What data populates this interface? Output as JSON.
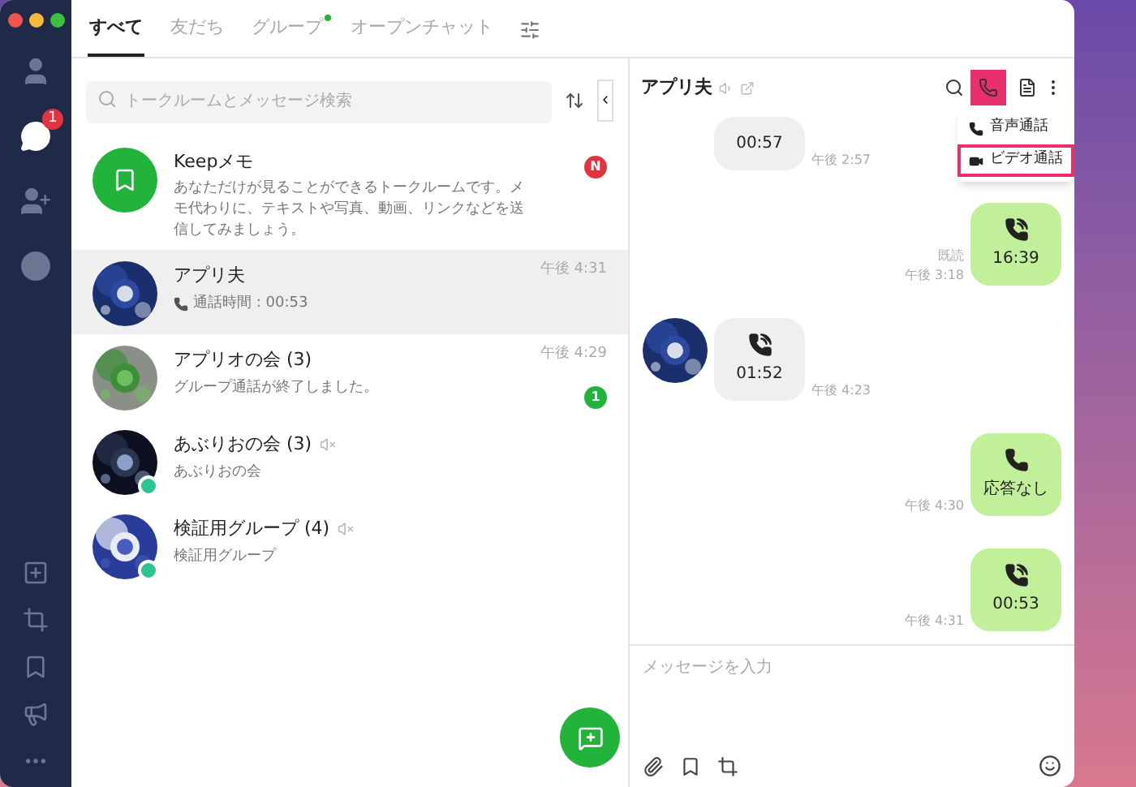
{
  "sidebar": {
    "items": [
      {
        "kind": "friends",
        "selected": false
      },
      {
        "kind": "chats",
        "selected": true,
        "badge": "1"
      },
      {
        "kind": "add-friend",
        "selected": false
      },
      {
        "kind": "history",
        "selected": false
      }
    ]
  },
  "tabs": [
    {
      "label": "すべて",
      "selected": true,
      "dot": false
    },
    {
      "label": "友だち",
      "selected": false,
      "dot": false
    },
    {
      "label": "グループ",
      "selected": false,
      "dot": true
    },
    {
      "label": "オープンチャット",
      "selected": false,
      "dot": false
    }
  ],
  "search": {
    "placeholder": "トークルームとメッセージ検索"
  },
  "chats": [
    {
      "kind": "keep",
      "name": "Keepメモ",
      "muted": false,
      "group": false,
      "preview": "あなただけが見ることができるトークルームです。メモ代わりに、テキストや写真、動画、リンクなどを送信してみましょう。",
      "preview_icon": false,
      "badge": "N",
      "color": "#e0343f",
      "selected": false
    },
    {
      "kind": "chat",
      "name": "アプリ夫",
      "muted": false,
      "group": false,
      "preview": "通話時間 : 00:53",
      "preview_icon": true,
      "time": "午後 4:31",
      "selected": true
    },
    {
      "kind": "chat",
      "name": "アプリオの会 (3)",
      "muted": false,
      "group": false,
      "preview": "グループ通話が終了しました。",
      "preview_icon": false,
      "time": "午後 4:29",
      "badge": "1",
      "color": "#22b33a",
      "selected": false
    },
    {
      "kind": "chat",
      "name": "あぶりおの会 (3)",
      "muted": true,
      "group": true,
      "preview": "あぶりおの会",
      "preview_icon": false,
      "selected": false
    },
    {
      "kind": "chat",
      "name": "検証用グループ (4)",
      "muted": true,
      "group": true,
      "preview": "検証用グループ",
      "preview_icon": false,
      "selected": false
    }
  ],
  "chat": {
    "title": "アプリ夫",
    "menu": [
      {
        "label": "音声通話",
        "kind": "voice",
        "selected": false
      },
      {
        "label": "ビデオ通話",
        "kind": "video",
        "selected": true
      }
    ],
    "messages": [
      {
        "kind": "incoming-partial",
        "text": "00:57",
        "time": "午後 2:57"
      },
      {
        "kind": "outgoing-call",
        "text": "16:39",
        "read": "既読",
        "time": "午後 3:18"
      },
      {
        "kind": "incoming-call",
        "avatar": true,
        "text": "01:52",
        "time": "午後 4:23"
      },
      {
        "kind": "outgoing-missed",
        "text": "応答なし",
        "time": "午後 4:30"
      },
      {
        "kind": "outgoing-call",
        "text": "00:53",
        "time": "午後 4:31"
      }
    ],
    "input": {
      "placeholder": "メッセージを入力"
    }
  }
}
